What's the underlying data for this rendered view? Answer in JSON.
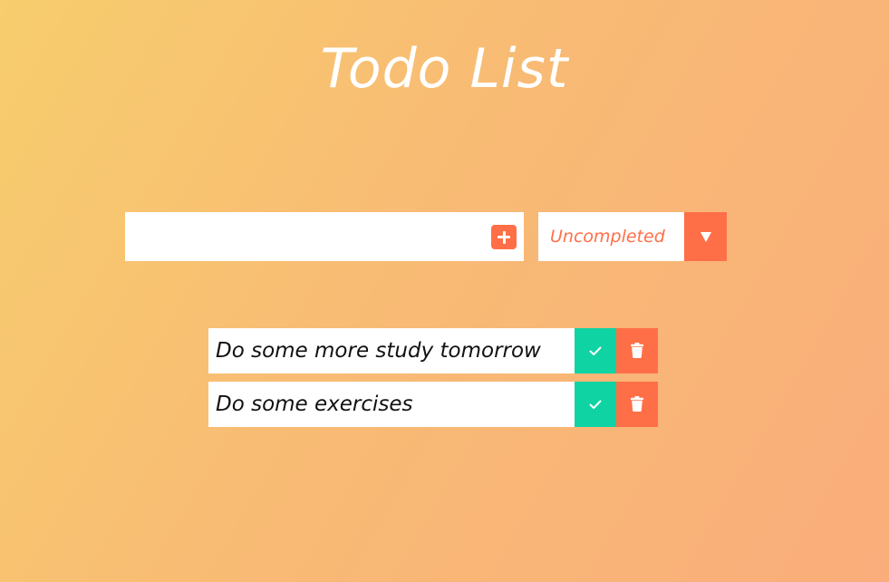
{
  "header": {
    "title": "Todo List"
  },
  "form": {
    "input_value": "",
    "add_icon": "plus-square-icon",
    "filter": {
      "selected": "Uncompleted",
      "arrow_icon": "caret-down-icon"
    }
  },
  "todos": [
    {
      "text": "Do some more study tomorrow",
      "complete_icon": "check-icon",
      "delete_icon": "trash-icon"
    },
    {
      "text": "Do some exercises",
      "complete_icon": "check-icon",
      "delete_icon": "trash-icon"
    }
  ],
  "colors": {
    "accent": "#ff6f47",
    "complete": "#0fd3a2",
    "background_start": "#f7cd6d",
    "background_end": "#faad7b"
  }
}
